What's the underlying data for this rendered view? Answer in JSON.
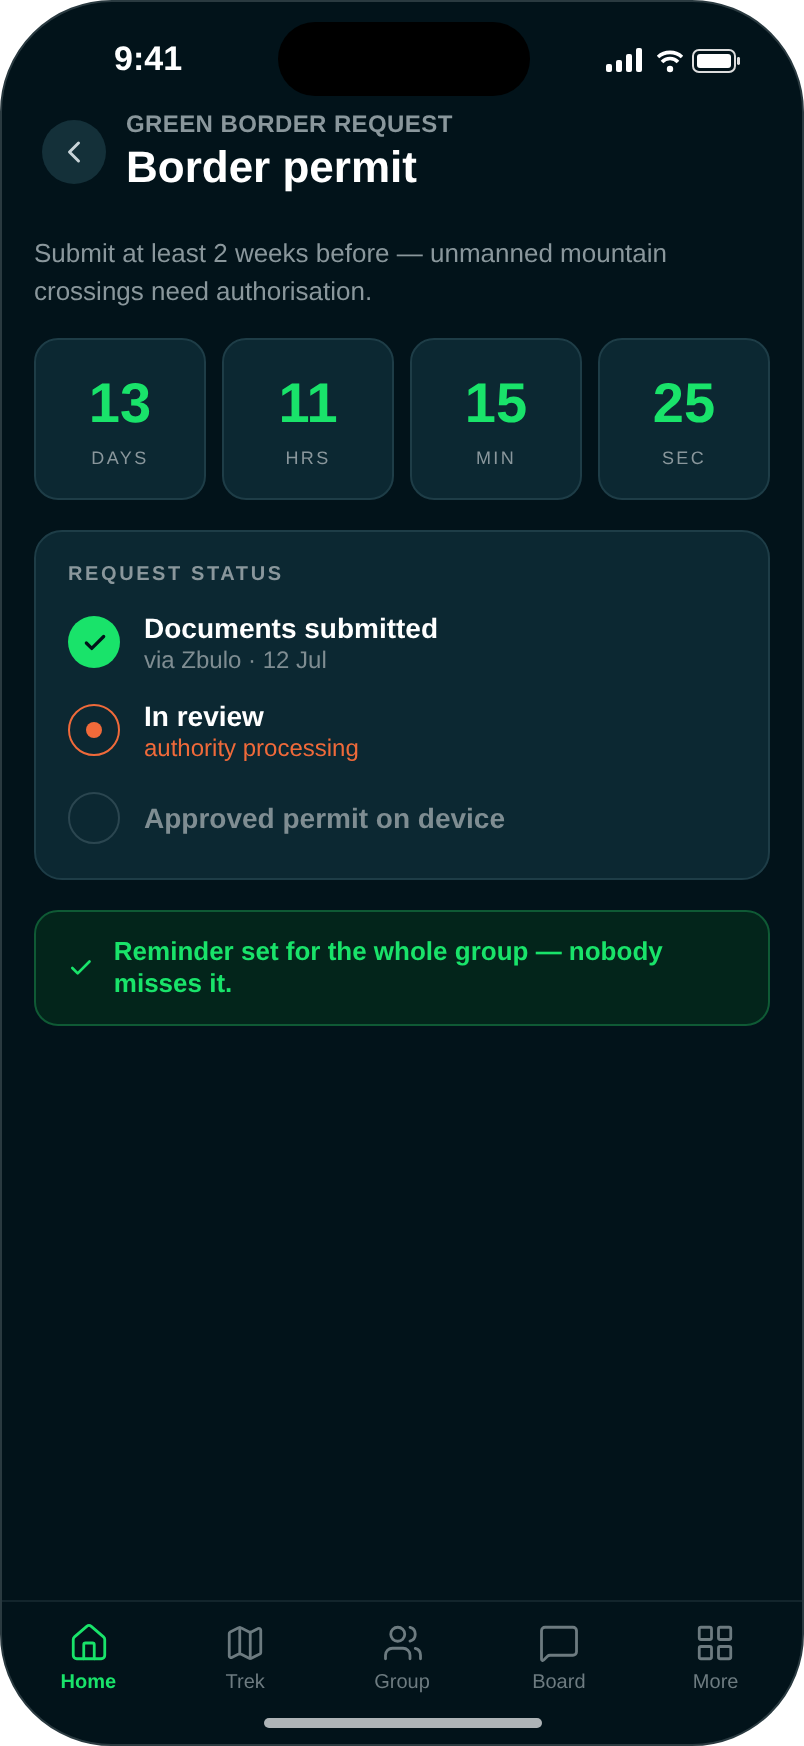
{
  "status_bar": {
    "time": "9:41"
  },
  "header": {
    "eyebrow": "GREEN BORDER REQUEST",
    "title": "Border permit"
  },
  "description": "Submit at least 2 weeks before — unmanned mountain crossings need authorisation.",
  "countdown": [
    {
      "value": "13",
      "unit": "DAYS"
    },
    {
      "value": "11",
      "unit": "HRS"
    },
    {
      "value": "15",
      "unit": "MIN"
    },
    {
      "value": "25",
      "unit": "SEC"
    }
  ],
  "request_status": {
    "heading": "REQUEST STATUS",
    "steps": [
      {
        "kind": "done",
        "title": "Documents submitted",
        "detail": "via Zbulo · 12 Jul"
      },
      {
        "kind": "current",
        "title": "In review",
        "detail": "authority processing"
      },
      {
        "kind": "pending",
        "title": "Approved permit on device"
      }
    ]
  },
  "notice": {
    "text": "Reminder set for the whole group — nobody misses it."
  },
  "tab_bar": [
    {
      "label": "Home",
      "selected": true
    },
    {
      "label": "Trek",
      "selected": false
    },
    {
      "label": "Group",
      "selected": false
    },
    {
      "label": "Board",
      "selected": false
    },
    {
      "label": "More",
      "selected": false
    }
  ]
}
